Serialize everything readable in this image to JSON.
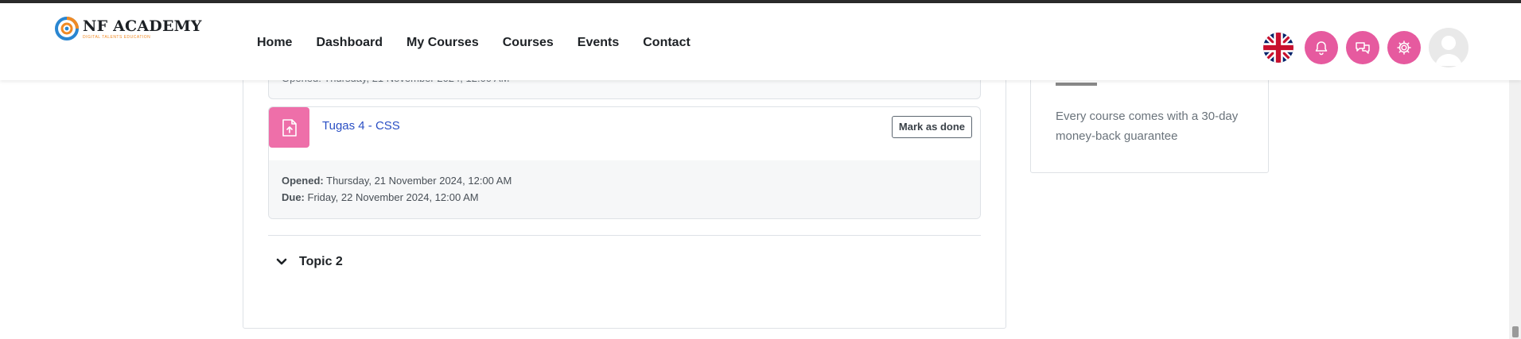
{
  "header": {
    "brand": "NF ACADEMY",
    "tagline": "DIGITAL TALENTS EDUCATION",
    "nav": [
      {
        "label": "Home"
      },
      {
        "label": "Dashboard"
      },
      {
        "label": "My Courses"
      },
      {
        "label": "Courses"
      },
      {
        "label": "Events"
      },
      {
        "label": "Contact"
      }
    ],
    "icons": [
      "uk-flag-icon",
      "bell-icon",
      "chat-icon",
      "gear-icon",
      "avatar"
    ],
    "accent_color": "#e65a9f"
  },
  "main": {
    "previous_activity_partial": "Opened: Thursday, 21 November 2024, 12:00 AM",
    "activity": {
      "icon": "assignment-upload-icon",
      "title": "Tugas 4 - CSS",
      "mark_done_label": "Mark as done",
      "opened_label": "Opened:",
      "opened_value": "Thursday, 21 November 2024, 12:00 AM",
      "due_label": "Due:",
      "due_value": "Friday, 22 November 2024, 12:00 AM"
    },
    "topic": {
      "title": "Topic 2",
      "icon": "chevron-down-icon"
    }
  },
  "sidebar": {
    "guarantee_text": "Every course comes with a 30-day money-back guarantee"
  }
}
